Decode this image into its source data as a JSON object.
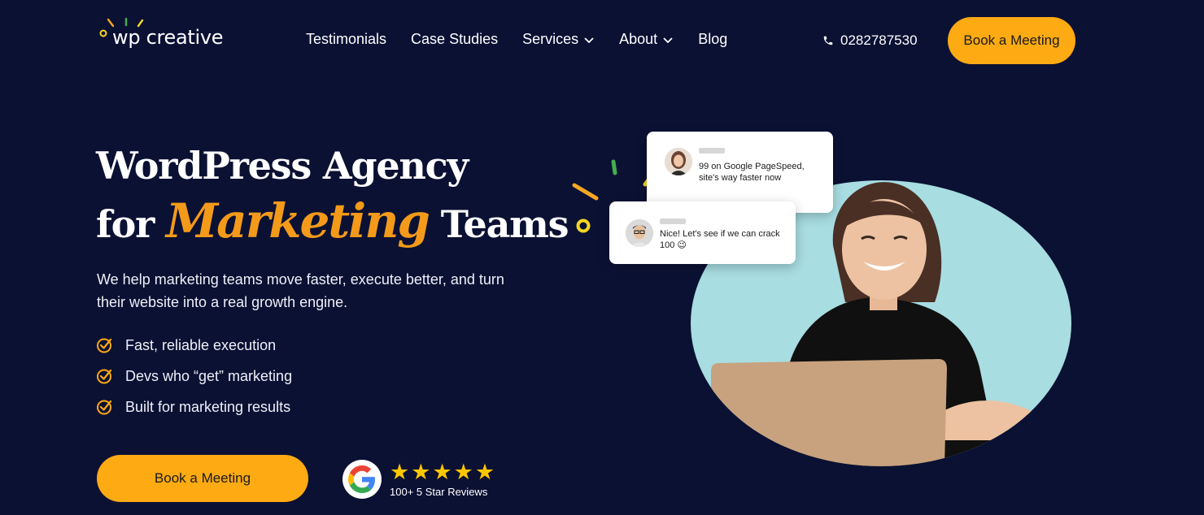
{
  "header": {
    "logo_text": "wp creative",
    "nav": [
      {
        "label": "Testimonials",
        "has_dropdown": false
      },
      {
        "label": "Case Studies",
        "has_dropdown": false
      },
      {
        "label": "Services",
        "has_dropdown": true
      },
      {
        "label": "About",
        "has_dropdown": true
      },
      {
        "label": "Blog",
        "has_dropdown": false
      }
    ],
    "phone": "0282787530",
    "cta_label": "Book a Meeting"
  },
  "hero": {
    "title_line1": "WordPress Agency",
    "title_for": "for",
    "title_script": "Marketing",
    "title_end": "Teams",
    "subtitle": "We help marketing teams move faster, execute better, and turn their website into a real growth engine.",
    "features": [
      "Fast, reliable execution",
      "Devs who “get” marketing",
      "Built for marketing results"
    ],
    "cta_label": "Book a Meeting",
    "reviews": {
      "rating_stars": 5,
      "label": "100+ 5 Star Reviews"
    }
  },
  "illustration": {
    "chat1_text": "99 on Google PageSpeed, site's way faster now",
    "chat2_text": "Nice! Let's see if we can crack 100 😉"
  },
  "colors": {
    "background": "#0b1133",
    "accent": "#fdaa13",
    "script_orange": "#f39a1a",
    "circle": "#a8dde2"
  },
  "icons": [
    "wp-creative-logo-icon",
    "chevron-down-icon",
    "phone-icon",
    "check-circle-icon",
    "google-icon",
    "star-icon"
  ]
}
